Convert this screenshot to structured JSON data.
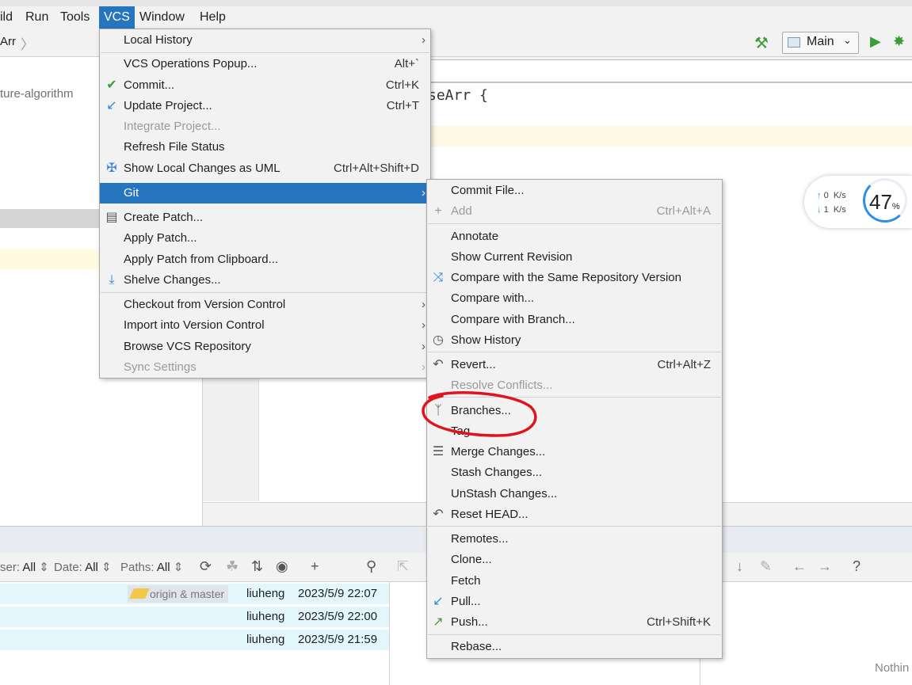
{
  "menubar": {
    "items": [
      "ild",
      "Run",
      "Tools",
      "VCS",
      "Window",
      "Help"
    ]
  },
  "navbar": {
    "breadcrumb": "Arr",
    "run_config": "Main"
  },
  "project_panel": {
    "tree_text": "ture-algorithm"
  },
  "editor": {
    "code": "seArr {"
  },
  "vcs_menu": {
    "items": [
      {
        "label": "Local History",
        "submenu": true
      },
      {
        "label": "VCS Operations Popup...",
        "shortcut": "Alt+`"
      },
      {
        "label": "Commit...",
        "shortcut": "Ctrl+K",
        "icon": "check-icon"
      },
      {
        "label": "Update Project...",
        "shortcut": "Ctrl+T",
        "icon": "update-arrow-icon"
      },
      {
        "label": "Integrate Project...",
        "disabled": true
      },
      {
        "label": "Refresh File Status"
      },
      {
        "label": "Show Local Changes as UML",
        "shortcut": "Ctrl+Alt+Shift+D",
        "icon": "uml-diagram-icon"
      },
      {
        "label": "Git",
        "submenu": true,
        "highlighted": true
      },
      {
        "label": "Create Patch...",
        "icon": "patch-file-icon"
      },
      {
        "label": "Apply Patch..."
      },
      {
        "label": "Apply Patch from Clipboard..."
      },
      {
        "label": "Shelve Changes...",
        "icon": "shelve-icon"
      },
      {
        "label": "Checkout from Version Control",
        "submenu": true
      },
      {
        "label": "Import into Version Control",
        "submenu": true
      },
      {
        "label": "Browse VCS Repository",
        "submenu": true
      },
      {
        "label": "Sync Settings",
        "submenu": true,
        "disabled": true
      }
    ]
  },
  "git_menu": {
    "items": [
      {
        "label": "Commit File..."
      },
      {
        "label": "Add",
        "shortcut": "Ctrl+Alt+A",
        "icon": "plus-icon",
        "disabled": true
      },
      {
        "label": "Annotate"
      },
      {
        "label": "Show Current Revision"
      },
      {
        "label": "Compare with the Same Repository Version",
        "icon": "compare-icon"
      },
      {
        "label": "Compare with..."
      },
      {
        "label": "Compare with Branch..."
      },
      {
        "label": "Show History",
        "icon": "clock-icon"
      },
      {
        "label": "Revert...",
        "shortcut": "Ctrl+Alt+Z",
        "icon": "revert-icon"
      },
      {
        "label": "Resolve Conflicts...",
        "disabled": true
      },
      {
        "label": "Branches...",
        "icon": "branch-icon"
      },
      {
        "label": "Tag..."
      },
      {
        "label": "Merge Changes...",
        "icon": "merge-icon"
      },
      {
        "label": "Stash Changes..."
      },
      {
        "label": "UnStash Changes..."
      },
      {
        "label": "Reset HEAD...",
        "icon": "reset-icon"
      },
      {
        "label": "Remotes..."
      },
      {
        "label": "Clone..."
      },
      {
        "label": "Fetch"
      },
      {
        "label": "Pull...",
        "icon": "pull-arrow-icon"
      },
      {
        "label": "Push...",
        "shortcut": "Ctrl+Shift+K",
        "icon": "push-arrow-icon"
      },
      {
        "label": "Rebase..."
      }
    ]
  },
  "log_toolbar": {
    "user_label": "ser:",
    "user_value": "All",
    "date_label": "Date:",
    "date_value": "All",
    "paths_label": "Paths:",
    "paths_value": "All"
  },
  "log_rows": [
    {
      "branch": "origin & master",
      "author": "liuheng",
      "date": "2023/5/9 22:07"
    },
    {
      "author": "liuheng",
      "date": "2023/5/9 22:00"
    },
    {
      "author": "liuheng",
      "date": "2023/5/9 21:59"
    }
  ],
  "details": {
    "empty_text": "Nothin"
  },
  "speed_widget": {
    "percent": "47",
    "percent_unit": "%",
    "upload": "0",
    "download": "1",
    "unit": "K/s"
  },
  "colors": {
    "menu_highlight": "#2675bf",
    "annotation": "#e0141e",
    "log_row_bg": "#e3f6fb"
  }
}
